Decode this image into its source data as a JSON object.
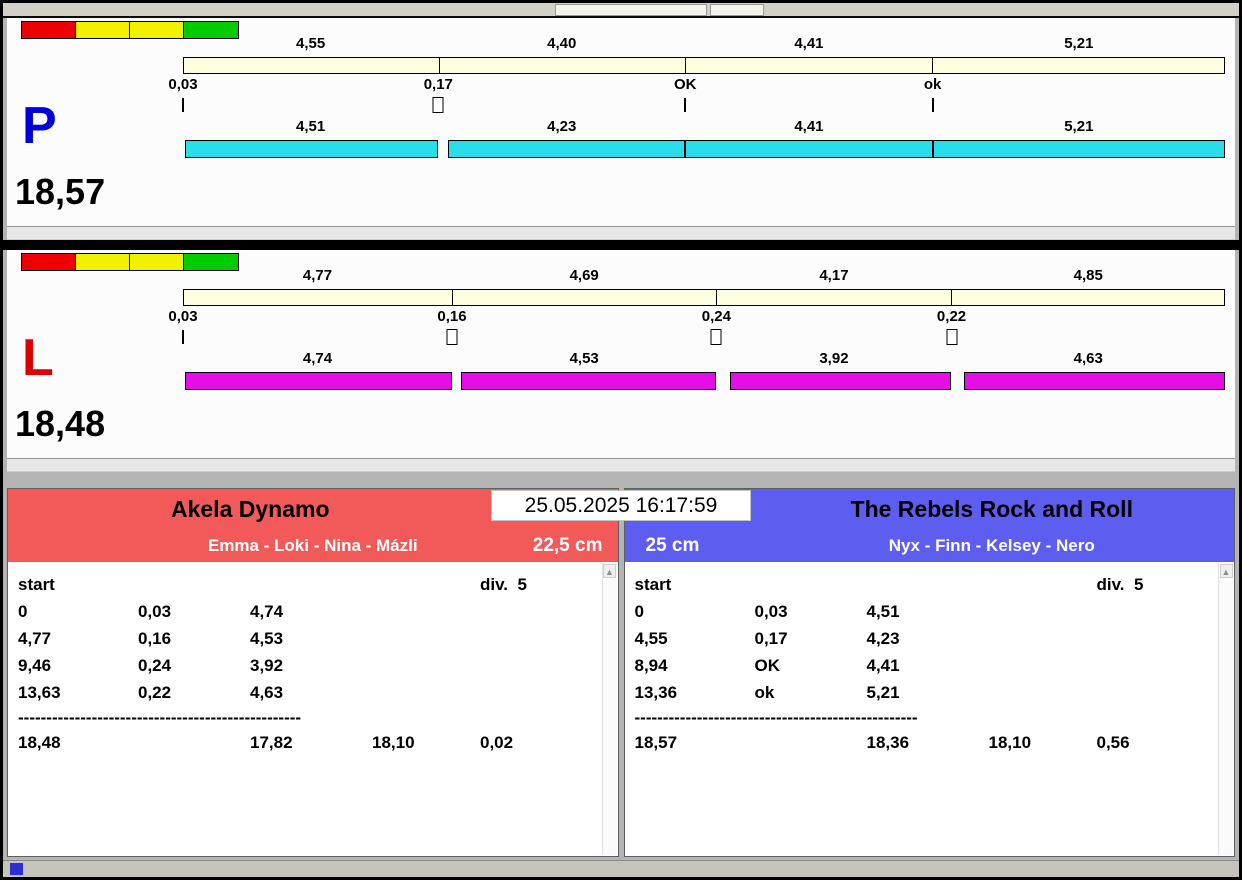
{
  "lanes": [
    {
      "key": "P",
      "letter": "P",
      "letter_color": "#0000dd",
      "bar_color": "#2adde8",
      "total_label": "18,57",
      "total": 18.57,
      "lights": [
        "#ee0000",
        "#f2f200",
        "#f2f200",
        "#00cc00"
      ],
      "segments": [
        {
          "split": "4,55",
          "split_v": 4.55,
          "loss": "0,03",
          "loss_v": 0.03,
          "marker": "tick",
          "dog": "4,51",
          "dog_v": 4.51
        },
        {
          "split": "4,40",
          "split_v": 4.4,
          "loss": "0,17",
          "loss_v": 0.17,
          "marker": "box",
          "dog": "4,23",
          "dog_v": 4.23
        },
        {
          "split": "4,41",
          "split_v": 4.41,
          "loss": "OK",
          "loss_v": 0,
          "marker": "tick",
          "dog": "4,41",
          "dog_v": 4.41
        },
        {
          "split": "5,21",
          "split_v": 5.21,
          "loss": "ok",
          "loss_v": 0,
          "marker": "tick",
          "dog": "5,21",
          "dog_v": 5.21
        }
      ]
    },
    {
      "key": "L",
      "letter": "L",
      "letter_color": "#dd0000",
      "bar_color": "#e60ee6",
      "total_label": "18,48",
      "total": 18.48,
      "lights": [
        "#ee0000",
        "#f2f200",
        "#f2f200",
        "#00cc00"
      ],
      "segments": [
        {
          "split": "4,77",
          "split_v": 4.77,
          "loss": "0,03",
          "loss_v": 0.03,
          "marker": "tick",
          "dog": "4,74",
          "dog_v": 4.74
        },
        {
          "split": "4,69",
          "split_v": 4.69,
          "loss": "0,16",
          "loss_v": 0.16,
          "marker": "box",
          "dog": "4,53",
          "dog_v": 4.53
        },
        {
          "split": "4,17",
          "split_v": 4.17,
          "loss": "0,24",
          "loss_v": 0.24,
          "marker": "box",
          "dog": "3,92",
          "dog_v": 3.92
        },
        {
          "split": "4,85",
          "split_v": 4.85,
          "loss": "0,22",
          "loss_v": 0.22,
          "marker": "box",
          "dog": "4,63",
          "dog_v": 4.63
        }
      ]
    }
  ],
  "scoreboard": {
    "timestamp": "25.05.2025 16:17:59",
    "left": {
      "team": "Akela Dynamo",
      "dogs": "Emma - Loki - Nina - Mázli",
      "height": "22,5 cm",
      "header_color": "#f25a5a",
      "rows": [
        [
          "start",
          "",
          "",
          "",
          "div.  5"
        ],
        [
          "0",
          "0,03",
          "4,74",
          "",
          ""
        ],
        [
          "4,77",
          "0,16",
          "4,53",
          "",
          ""
        ],
        [
          "9,46",
          "0,24",
          "3,92",
          "",
          ""
        ],
        [
          "13,63",
          "0,22",
          "4,63",
          "",
          ""
        ]
      ],
      "separator": "--------------------------------------------------",
      "totals": [
        "18,48",
        "",
        "17,82",
        "18,10",
        "0,02"
      ]
    },
    "right": {
      "team": "The Rebels Rock and Roll",
      "dogs": "Nyx - Finn - Kelsey - Nero",
      "height": "25 cm",
      "header_color": "#5d5df0",
      "rows": [
        [
          "start",
          "",
          "",
          "",
          "div.  5"
        ],
        [
          "0",
          "0,03",
          "4,51",
          "",
          ""
        ],
        [
          "4,55",
          "0,17",
          "4,23",
          "",
          ""
        ],
        [
          "8,94",
          "OK",
          "4,41",
          "",
          ""
        ],
        [
          "13,36",
          "ok",
          "5,21",
          "",
          ""
        ]
      ],
      "separator": "--------------------------------------------------",
      "totals": [
        "18,57",
        "",
        "18,36",
        "18,10",
        "0,56"
      ]
    }
  }
}
